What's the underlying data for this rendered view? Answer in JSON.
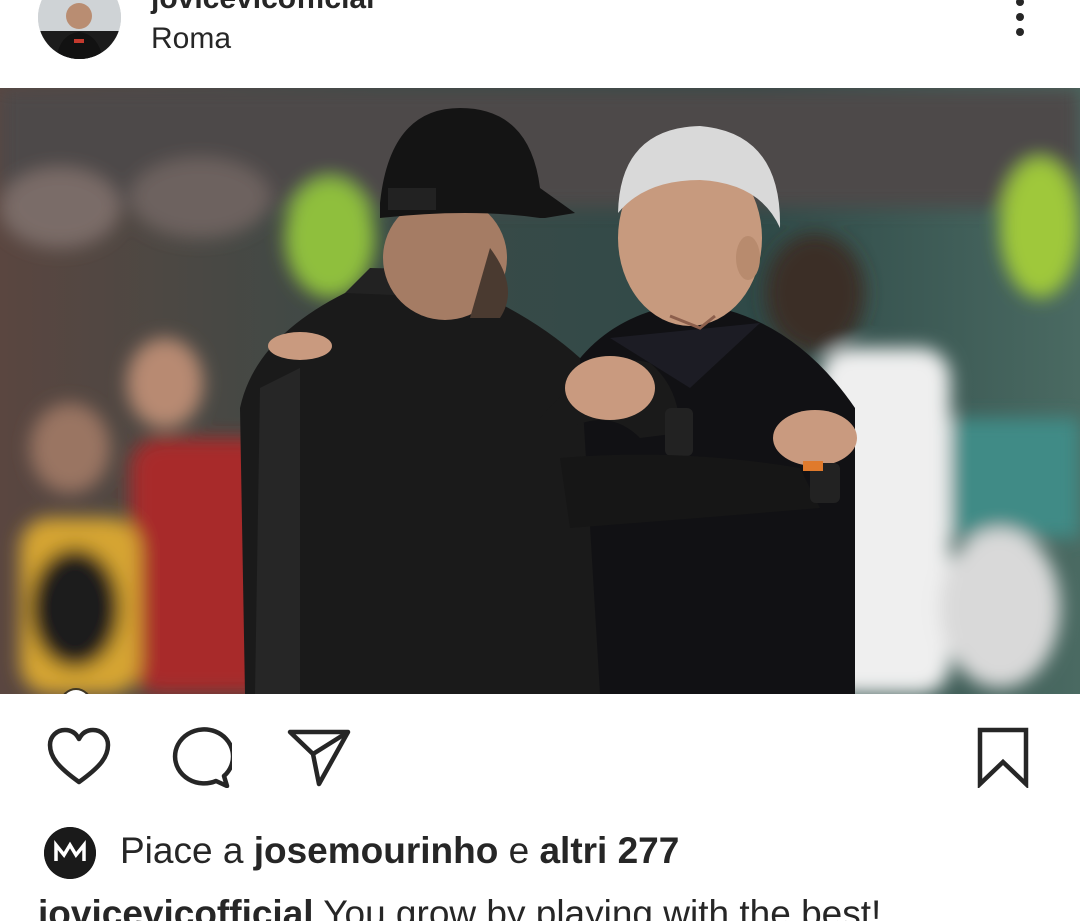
{
  "header": {
    "username": "jovicevicofficial",
    "location": "Roma"
  },
  "photo": {
    "alt_icon": "tag-user-icon"
  },
  "actions": {
    "like_icon": "heart-icon",
    "comment_icon": "comment-icon",
    "share_icon": "send-icon",
    "save_icon": "bookmark-icon"
  },
  "likes": {
    "prefix": "Piace a",
    "first_liker": "josemourinho",
    "conjunction": "e",
    "others": "altri 277"
  },
  "caption": {
    "username": "jovicevicofficial",
    "text": "You grow by playing with the best!"
  },
  "colors": {
    "text": "#262626",
    "background": "#ffffff"
  }
}
